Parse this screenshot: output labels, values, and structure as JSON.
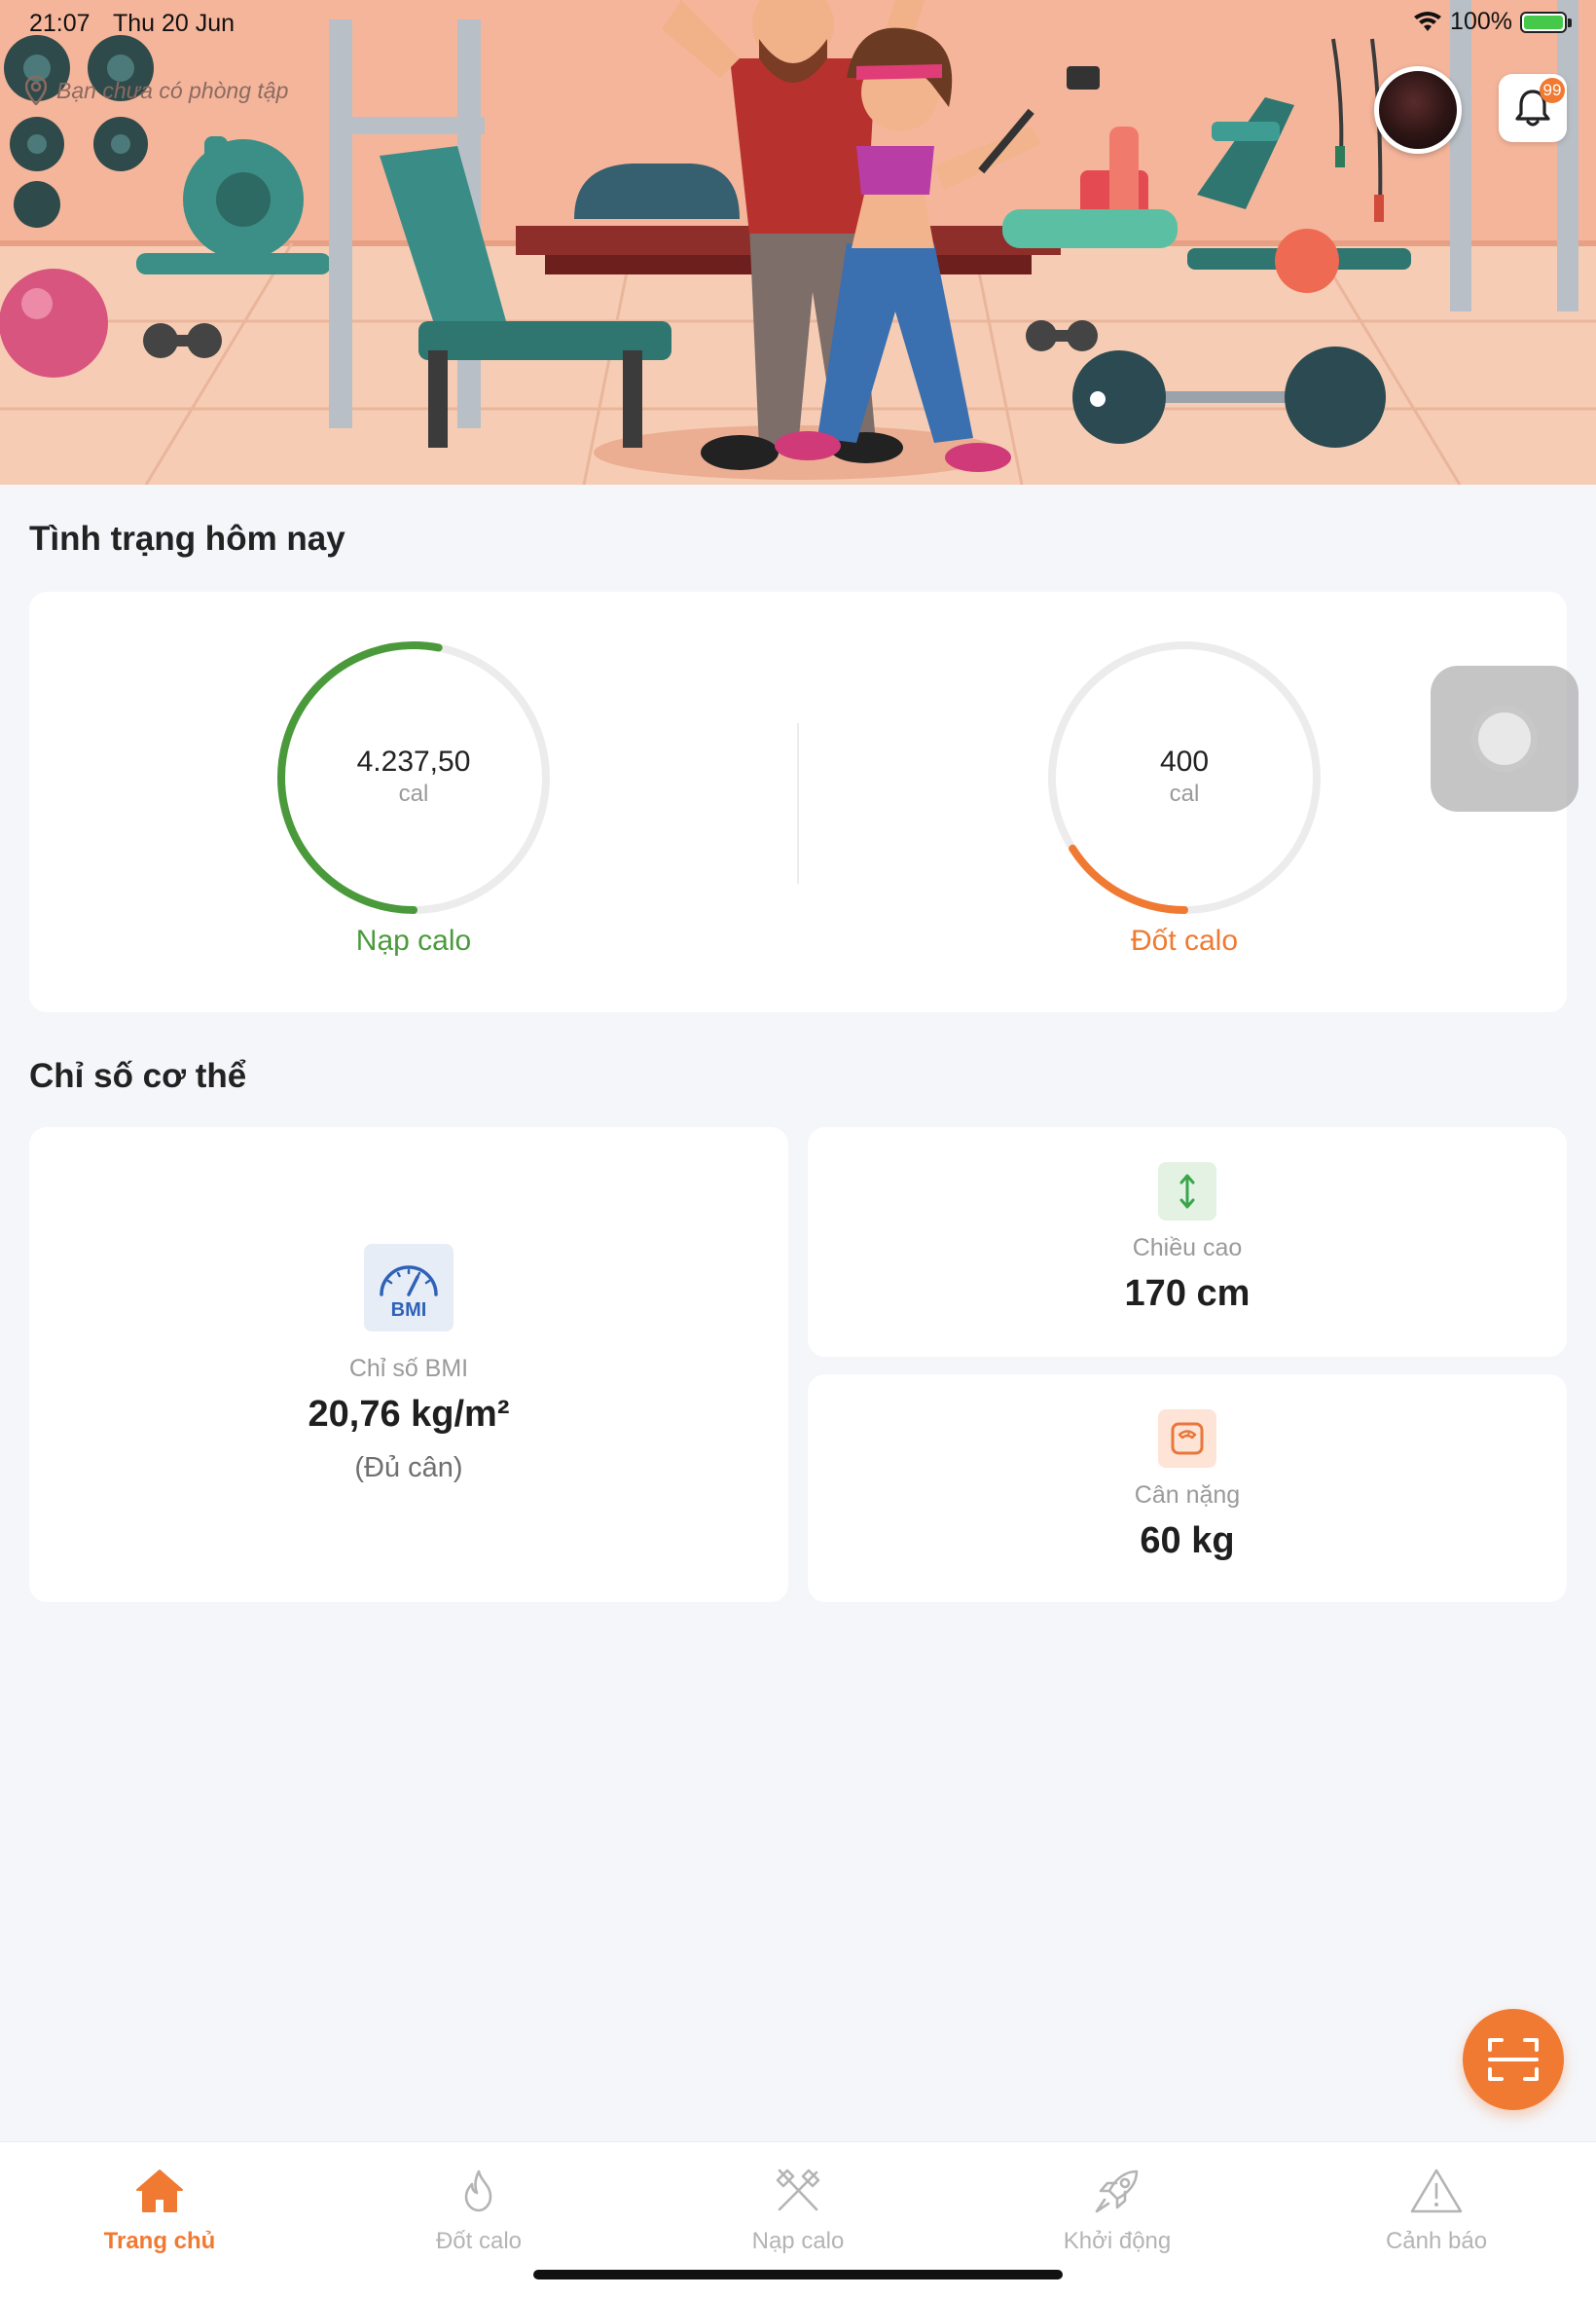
{
  "status_bar": {
    "time": "21:07",
    "date": "Thu 20 Jun",
    "battery": "100%"
  },
  "header": {
    "gym_location": "Bạn chưa có phòng tập",
    "notification_count": "99",
    "icons": [
      "location-pin-icon",
      "avatar",
      "bell-icon"
    ]
  },
  "today": {
    "title": "Tình trạng hôm nay",
    "intake": {
      "value": "4.237,50",
      "unit": "cal",
      "label": "Nạp calo",
      "progress": 0.53,
      "color": "#4a9a3c"
    },
    "burn": {
      "value": "400",
      "unit": "cal",
      "label": "Đốt calo",
      "progress": 0.16,
      "color": "#f07a32"
    }
  },
  "body": {
    "title": "Chỉ số cơ thể",
    "bmi": {
      "label": "Chỉ số BMI",
      "value": "20,76 kg/m²",
      "note": "(Đủ cân)",
      "icon_text": "BMI"
    },
    "height": {
      "label": "Chiều cao",
      "value": "170 cm"
    },
    "weight": {
      "label": "Cân nặng",
      "value": "60 kg"
    }
  },
  "nav": {
    "items": [
      {
        "label": "Trang chủ",
        "icon": "home-icon",
        "active": true
      },
      {
        "label": "Đốt calo",
        "icon": "flame-icon",
        "active": false
      },
      {
        "label": "Nạp calo",
        "icon": "fork-knife-icon",
        "active": false
      },
      {
        "label": "Khởi động",
        "icon": "rocket-icon",
        "active": false
      },
      {
        "label": "Cảnh báo",
        "icon": "warning-icon",
        "active": false
      }
    ]
  },
  "colors": {
    "accent": "#f07a32",
    "green": "#4a9a3c",
    "background": "#f5f6fa"
  }
}
